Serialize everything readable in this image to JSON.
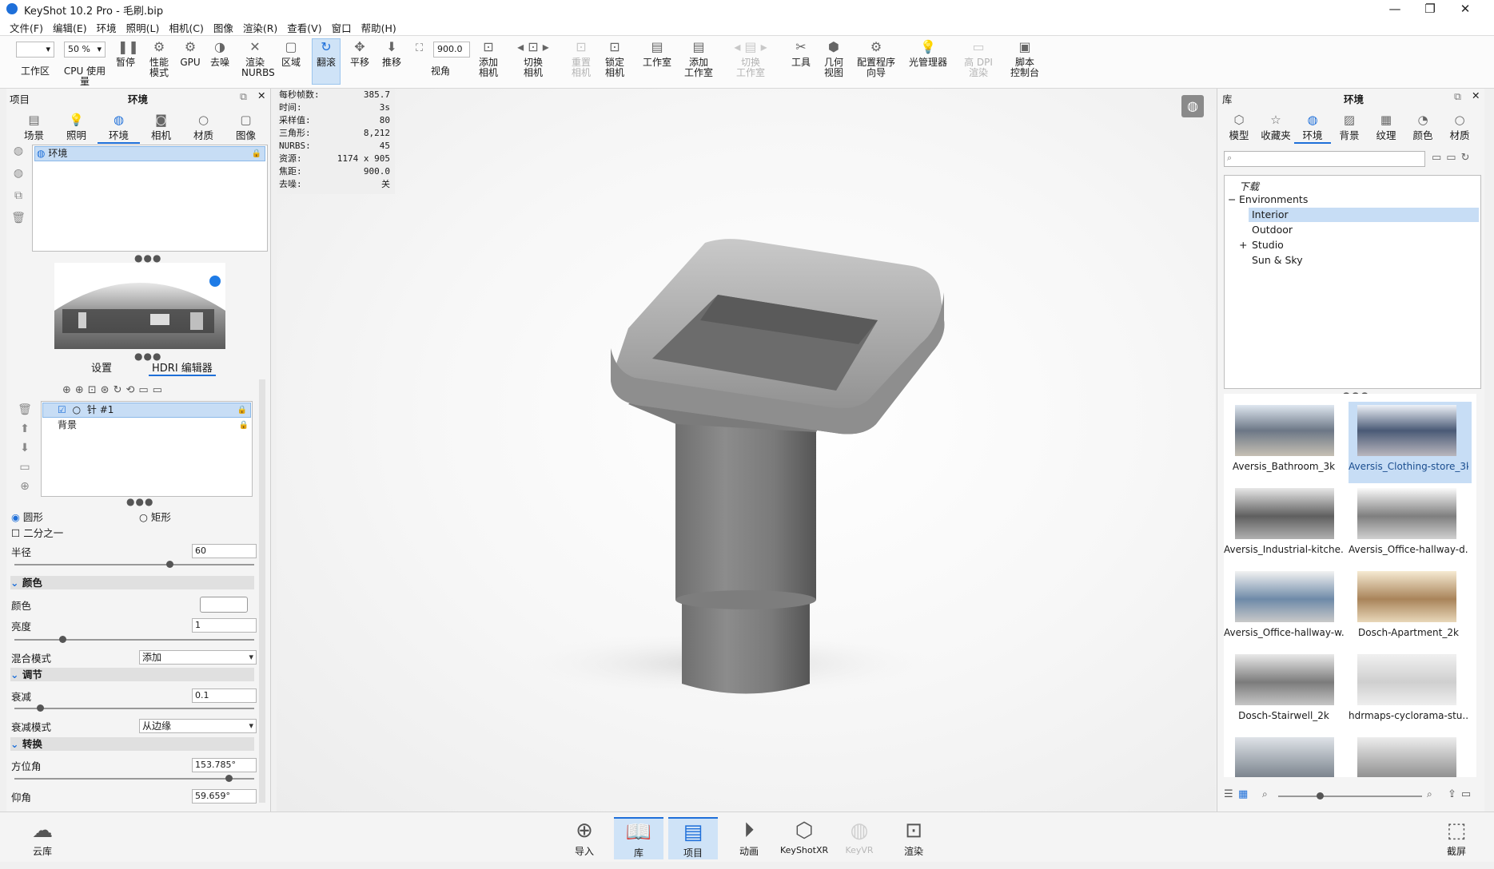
{
  "titlebar": {
    "title": "KeyShot 10.2 Pro  - 毛刷.bip",
    "minimize": "—",
    "maximize": "❐",
    "close": "✕"
  },
  "menu": [
    "文件(F)",
    "编辑(E)",
    "环境",
    "照明(L)",
    "相机(C)",
    "图像",
    "渲染(R)",
    "查看(V)",
    "窗口",
    "帮助(H)"
  ],
  "toolbar": {
    "zoom_value": "50 %",
    "fov_value": "900.0",
    "items": {
      "workspace": "工作区",
      "cpu": "CPU 使用量",
      "pause": "暂停",
      "perf": "性能\n模式",
      "gpu": "GPU",
      "denoise": "去噪",
      "nurbs": "渲染\nNURBS",
      "region": "区域",
      "tumble": "翻滚",
      "pan": "平移",
      "dolly": "推移",
      "fov": "视角",
      "add_camera": "添加\n相机",
      "switch_camera": "切换\n相机",
      "reset_camera": "重置\n相机",
      "lock_camera": "锁定\n相机",
      "studio": "工作室",
      "add_studio": "添加\n工作室",
      "switch_studio": "切换\n工作室",
      "tools": "工具",
      "geometry": "几何\n视图",
      "config": "配置程序\n向导",
      "light_manager": "光管理器",
      "hidpi": "高 DPI\n渲染",
      "script": "脚本\n控制台"
    }
  },
  "left": {
    "header_left": "项目",
    "header_title": "环境",
    "tabs": [
      "场景",
      "照明",
      "环境",
      "相机",
      "材质",
      "图像"
    ],
    "env_item": "环境",
    "subtabs": [
      "设置",
      "HDRI 编辑器"
    ],
    "pins": [
      "针 #1",
      "背景"
    ],
    "shape_circle": "圆形",
    "shape_rect": "矩形",
    "half": "二分之一",
    "radius_label": "半径",
    "radius_value": "60",
    "section_color": "颜色",
    "color_label": "颜色",
    "brightness_label": "亮度",
    "brightness_value": "1",
    "blend_label": "混合模式",
    "blend_value": "添加",
    "section_adjust": "调节",
    "falloff_label": "衰减",
    "falloff_value": "0.1",
    "falloff_mode_label": "衰减模式",
    "falloff_mode_value": "从边缘",
    "section_transform": "转换",
    "azimuth_label": "方位角",
    "azimuth_value": "153.785°",
    "elevation_label": "仰角",
    "elevation_value": "59.659°"
  },
  "stats": [
    {
      "k": "每秒帧数:",
      "v": "385.7"
    },
    {
      "k": "时间:",
      "v": "3s"
    },
    {
      "k": "采样值:",
      "v": "80"
    },
    {
      "k": "三角形:",
      "v": "8,212"
    },
    {
      "k": "NURBS:",
      "v": "45"
    },
    {
      "k": "资源:",
      "v": "1174 x 905"
    },
    {
      "k": "焦距:",
      "v": "900.0"
    },
    {
      "k": "去噪:",
      "v": "关"
    }
  ],
  "right": {
    "header_left": "库",
    "header_title": "环境",
    "tabs": [
      "模型",
      "收藏夹",
      "环境",
      "背景",
      "纹理",
      "颜色",
      "材质"
    ],
    "tree": [
      "下载",
      "Environments",
      "Interior",
      "Outdoor",
      "Studio",
      "Sun & Sky"
    ],
    "thumbs": [
      "Aversis_Bathroom_3k",
      "Aversis_Clothing-store_3k",
      "Aversis_Industrial-kitche...",
      "Aversis_Office-hallway-d...",
      "Aversis_Office-hallway-w...",
      "Dosch-Apartment_2k",
      "Dosch-Stairwell_2k",
      "hdrmaps-cyclorama-stu..."
    ]
  },
  "bottom": {
    "cloud": "云库",
    "import": "导入",
    "library": "库",
    "project": "项目",
    "animation": "动画",
    "keyshotxr": "KeyShotXR",
    "keyvr": "KeyVR",
    "render": "渲染",
    "screenshot": "截屏"
  }
}
